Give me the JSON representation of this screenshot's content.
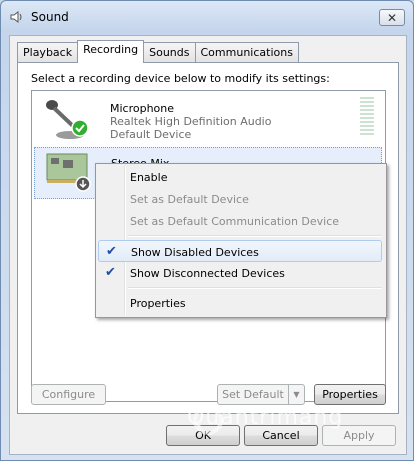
{
  "window": {
    "title": "Sound",
    "close_glyph": "✕"
  },
  "tabs": [
    {
      "label": "Playback"
    },
    {
      "label": "Recording"
    },
    {
      "label": "Sounds"
    },
    {
      "label": "Communications"
    }
  ],
  "instruction": "Select a recording device below to modify its settings:",
  "devices": [
    {
      "name": "Microphone",
      "driver": "Realtek High Definition Audio",
      "status": "Default Device",
      "icon": "microphone-icon"
    },
    {
      "name": "Stereo Mix",
      "icon": "sound-card-icon"
    }
  ],
  "context_menu": {
    "items": [
      {
        "label": "Enable",
        "enabled": true,
        "checked": false
      },
      {
        "label": "Set as Default Device",
        "enabled": false,
        "checked": false
      },
      {
        "label": "Set as Default Communication Device",
        "enabled": false,
        "checked": false
      },
      {
        "label": "Show Disabled Devices",
        "enabled": true,
        "checked": true
      },
      {
        "label": "Show Disconnected Devices",
        "enabled": true,
        "checked": true
      },
      {
        "label": "Properties",
        "enabled": true,
        "checked": false
      }
    ]
  },
  "buttons": {
    "configure": "Configure",
    "set_default": "Set Default",
    "properties": "Properties",
    "ok": "OK",
    "cancel": "Cancel",
    "apply": "Apply"
  },
  "watermark": "Quantrimang"
}
